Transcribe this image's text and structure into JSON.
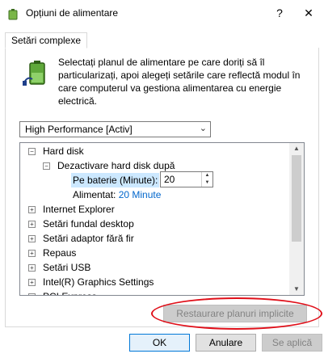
{
  "window": {
    "title": "Opțiuni de alimentare",
    "help_glyph": "?",
    "close_glyph": "✕",
    "icon": "power-options-icon"
  },
  "tab": {
    "label": "Setări complexe"
  },
  "description": "Selectați planul de alimentare pe care doriți să îl particularizați, apoi alegeți setările care reflectă modul în care computerul va gestiona alimentarea cu energie electrică.",
  "plan_dropdown": {
    "selected": "High Performance [Activ]"
  },
  "tree": {
    "hard_disk": "Hard disk",
    "turn_off_after": "Dezactivare hard disk după",
    "on_battery_label": "Pe baterie (Minute):",
    "on_battery_value": "20",
    "plugged_in_label": "Alimentat:",
    "plugged_in_value": "20 Minute",
    "items": [
      "Internet Explorer",
      "Setări fundal desktop",
      "Setări adaptor fără fir",
      "Repaus",
      "Setări USB",
      "Intel(R) Graphics Settings",
      "PCI Express"
    ]
  },
  "buttons": {
    "restore": "Restaurare planuri implicite",
    "ok": "OK",
    "cancel": "Anulare",
    "apply": "Se aplică"
  },
  "colors": {
    "annotation_oval": "#e0101a",
    "link": "#0066cc",
    "selection": "#cce8ff"
  }
}
